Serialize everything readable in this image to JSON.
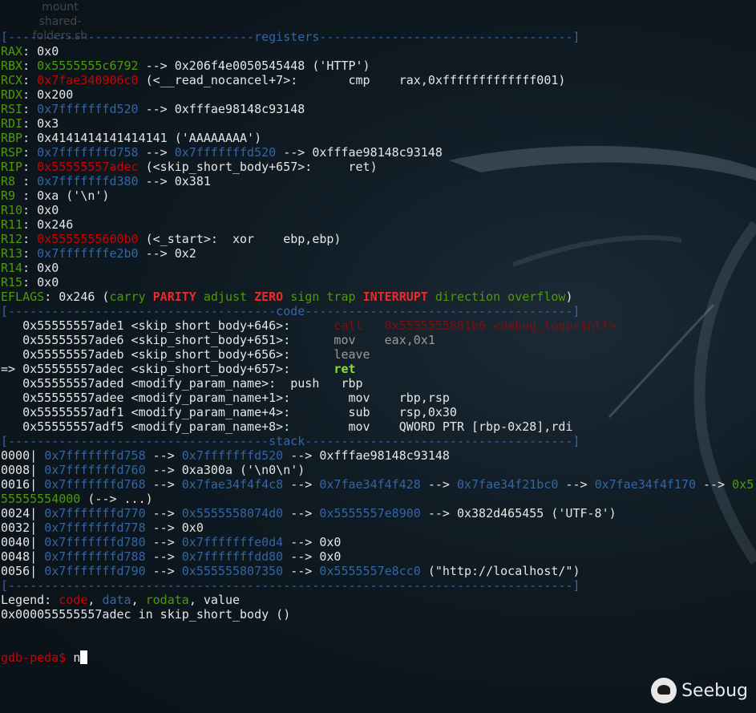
{
  "desktop_icon_label": [
    "mount",
    "shared-",
    "folders.sh"
  ],
  "logo_text": "Seebug",
  "prompt": {
    "label": "gdb-peda$ ",
    "input": "n"
  },
  "lines": [
    [
      [
        "[----------------------------------",
        "b"
      ],
      [
        "registers",
        "b"
      ],
      [
        "-----------------------------------]",
        "b"
      ]
    ],
    [
      [
        "RAX",
        "g"
      ],
      [
        ": 0x0",
        "w"
      ]
    ],
    [
      [
        "RBX",
        "g"
      ],
      [
        ": ",
        "w"
      ],
      [
        "0x5555555c6792",
        "g"
      ],
      [
        " --> 0x206f4e0050545448 ('HTTP')",
        "w"
      ]
    ],
    [
      [
        "RCX",
        "g"
      ],
      [
        ": ",
        "w"
      ],
      [
        "0x7fae340906c0",
        "r"
      ],
      [
        " (<__read_nocancel+7>:       cmp    rax,0xfffffffffffff001)",
        "w"
      ]
    ],
    [
      [
        "RDX",
        "g"
      ],
      [
        ": 0x200",
        "w"
      ]
    ],
    [
      [
        "RSI",
        "g"
      ],
      [
        ": ",
        "w"
      ],
      [
        "0x7fffffffd520",
        "b"
      ],
      [
        " --> 0xfffae98148c93148",
        "w"
      ]
    ],
    [
      [
        "RDI",
        "g"
      ],
      [
        ": 0x3",
        "w"
      ]
    ],
    [
      [
        "RBP",
        "g"
      ],
      [
        ": 0x4141414141414141 ('AAAAAAAA')",
        "w"
      ]
    ],
    [
      [
        "RSP",
        "g"
      ],
      [
        ": ",
        "w"
      ],
      [
        "0x7fffffffd758",
        "b"
      ],
      [
        " --> ",
        "w"
      ],
      [
        "0x7fffffffd520",
        "b"
      ],
      [
        " --> 0xfffae98148c93148",
        "w"
      ]
    ],
    [
      [
        "RIP",
        "g"
      ],
      [
        ": ",
        "w"
      ],
      [
        "0x55555557adec",
        "r"
      ],
      [
        " (<skip_short_body+657>:     ret)",
        "w"
      ]
    ],
    [
      [
        "R8 ",
        "g"
      ],
      [
        ": ",
        "w"
      ],
      [
        "0x7fffffffd380",
        "b"
      ],
      [
        " --> 0x381",
        "w"
      ]
    ],
    [
      [
        "R9 ",
        "g"
      ],
      [
        ": 0xa ('\\n')",
        "w"
      ]
    ],
    [
      [
        "R10",
        "g"
      ],
      [
        ": 0x0",
        "w"
      ]
    ],
    [
      [
        "R11",
        "g"
      ],
      [
        ": 0x246",
        "w"
      ]
    ],
    [
      [
        "R12",
        "g"
      ],
      [
        ": ",
        "w"
      ],
      [
        "0x5555555600b0",
        "r"
      ],
      [
        " (<_start>:  xor    ebp,ebp)",
        "w"
      ]
    ],
    [
      [
        "R13",
        "g"
      ],
      [
        ": ",
        "w"
      ],
      [
        "0x7fffffffe2b0",
        "b"
      ],
      [
        " --> 0x2",
        "w"
      ]
    ],
    [
      [
        "R14",
        "g"
      ],
      [
        ": 0x0",
        "w"
      ]
    ],
    [
      [
        "R15",
        "g"
      ],
      [
        ": 0x0",
        "w"
      ]
    ],
    [
      [
        "EFLAGS",
        "g"
      ],
      [
        ": 0x246 (",
        "w"
      ],
      [
        "carry ",
        "g"
      ],
      [
        "PARITY",
        "R"
      ],
      [
        " adjust ",
        "g"
      ],
      [
        "ZERO",
        "R"
      ],
      [
        " sign trap ",
        "g"
      ],
      [
        "INTERRUPT",
        "R"
      ],
      [
        " direction overflow",
        "g"
      ],
      [
        ")",
        "w"
      ]
    ],
    [
      [
        "[-------------------------------------",
        "b"
      ],
      [
        "code",
        "b"
      ],
      [
        "-------------------------------------]",
        "b"
      ]
    ],
    [
      [
        "   0x55555557ade1 <skip_short_body+646>:      ",
        "w"
      ],
      [
        "call   0x5555555861b6 <debug_logprintf>",
        "dr"
      ]
    ],
    [
      [
        "   0x55555557ade6 <skip_short_body+651>:      ",
        "w"
      ],
      [
        "mov    eax,0x1",
        "gr"
      ]
    ],
    [
      [
        "   0x55555557adeb <skip_short_body+656>:      ",
        "w"
      ],
      [
        "leave",
        "gr"
      ]
    ],
    [
      [
        "=> 0x55555557adec <skip_short_body+657>:      ",
        "w"
      ],
      [
        "ret",
        "G"
      ]
    ],
    [
      [
        "   0x55555557aded <modify_param_name>:  push   rbp",
        "w"
      ]
    ],
    [
      [
        "   0x55555557adee <modify_param_name+1>:        mov    rbp,rsp",
        "w"
      ]
    ],
    [
      [
        "   0x55555557adf1 <modify_param_name+4>:        sub    rsp,0x30",
        "w"
      ]
    ],
    [
      [
        "   0x55555557adf5 <modify_param_name+8>:        mov    QWORD PTR [rbp-0x28],rdi",
        "w"
      ]
    ],
    [
      [
        "[------------------------------------",
        "b"
      ],
      [
        "stack",
        "b"
      ],
      [
        "-------------------------------------]",
        "b"
      ]
    ],
    [
      [
        "0000| ",
        "w"
      ],
      [
        "0x7fffffffd758",
        "b"
      ],
      [
        " --> ",
        "w"
      ],
      [
        "0x7fffffffd520",
        "b"
      ],
      [
        " --> 0xfffae98148c93148",
        "w"
      ]
    ],
    [
      [
        "0008| ",
        "w"
      ],
      [
        "0x7fffffffd760",
        "b"
      ],
      [
        " --> 0xa300a ('\\n0\\n')",
        "w"
      ]
    ],
    [
      [
        "0016| ",
        "w"
      ],
      [
        "0x7fffffffd768",
        "b"
      ],
      [
        " --> ",
        "w"
      ],
      [
        "0x7fae34f4f4c8",
        "b"
      ],
      [
        " --> ",
        "w"
      ],
      [
        "0x7fae34f4f428",
        "b"
      ],
      [
        " --> ",
        "w"
      ],
      [
        "0x7fae34f21bc0",
        "b"
      ],
      [
        " --> ",
        "w"
      ],
      [
        "0x7fae34f4f170",
        "b"
      ],
      [
        " --> ",
        "w"
      ],
      [
        "0x5",
        "g"
      ]
    ],
    [
      [
        "55555554000",
        "g"
      ],
      [
        " (--> ...)",
        "w"
      ]
    ],
    [
      [
        "0024| ",
        "w"
      ],
      [
        "0x7fffffffd770",
        "b"
      ],
      [
        " --> ",
        "w"
      ],
      [
        "0x5555558074d0",
        "b"
      ],
      [
        " --> ",
        "w"
      ],
      [
        "0x5555557e8900",
        "b"
      ],
      [
        " --> 0x382d465455 ('UTF-8')",
        "w"
      ]
    ],
    [
      [
        "0032| ",
        "w"
      ],
      [
        "0x7fffffffd778",
        "b"
      ],
      [
        " --> 0x0",
        "w"
      ]
    ],
    [
      [
        "0040| ",
        "w"
      ],
      [
        "0x7fffffffd780",
        "b"
      ],
      [
        " --> ",
        "w"
      ],
      [
        "0x7fffffffe0d4",
        "b"
      ],
      [
        " --> 0x0",
        "w"
      ]
    ],
    [
      [
        "0048| ",
        "w"
      ],
      [
        "0x7fffffffd788",
        "b"
      ],
      [
        " --> ",
        "w"
      ],
      [
        "0x7fffffffdd80",
        "b"
      ],
      [
        " --> 0x0",
        "w"
      ]
    ],
    [
      [
        "0056| ",
        "w"
      ],
      [
        "0x7fffffffd790",
        "b"
      ],
      [
        " --> ",
        "w"
      ],
      [
        "0x555555807350",
        "b"
      ],
      [
        " --> ",
        "w"
      ],
      [
        "0x5555557e8cc0",
        "b"
      ],
      [
        " (\"http://localhost/\")",
        "w"
      ]
    ],
    [
      [
        "[------------------------------------------------------------------------------]",
        "b"
      ]
    ],
    [
      [
        "Legend: ",
        "w"
      ],
      [
        "code",
        "r"
      ],
      [
        ", ",
        "w"
      ],
      [
        "data",
        "b"
      ],
      [
        ", ",
        "w"
      ],
      [
        "rodata",
        "g"
      ],
      [
        ", value",
        "w"
      ]
    ],
    [
      [
        "0x000055555557adec in skip_short_body ()",
        "w"
      ]
    ]
  ],
  "colors": {
    "green": "#4e9a06",
    "blue": "#3465a4",
    "red": "#cc0000",
    "bold_red": "#ef2929",
    "bright_green": "#8ae234"
  }
}
